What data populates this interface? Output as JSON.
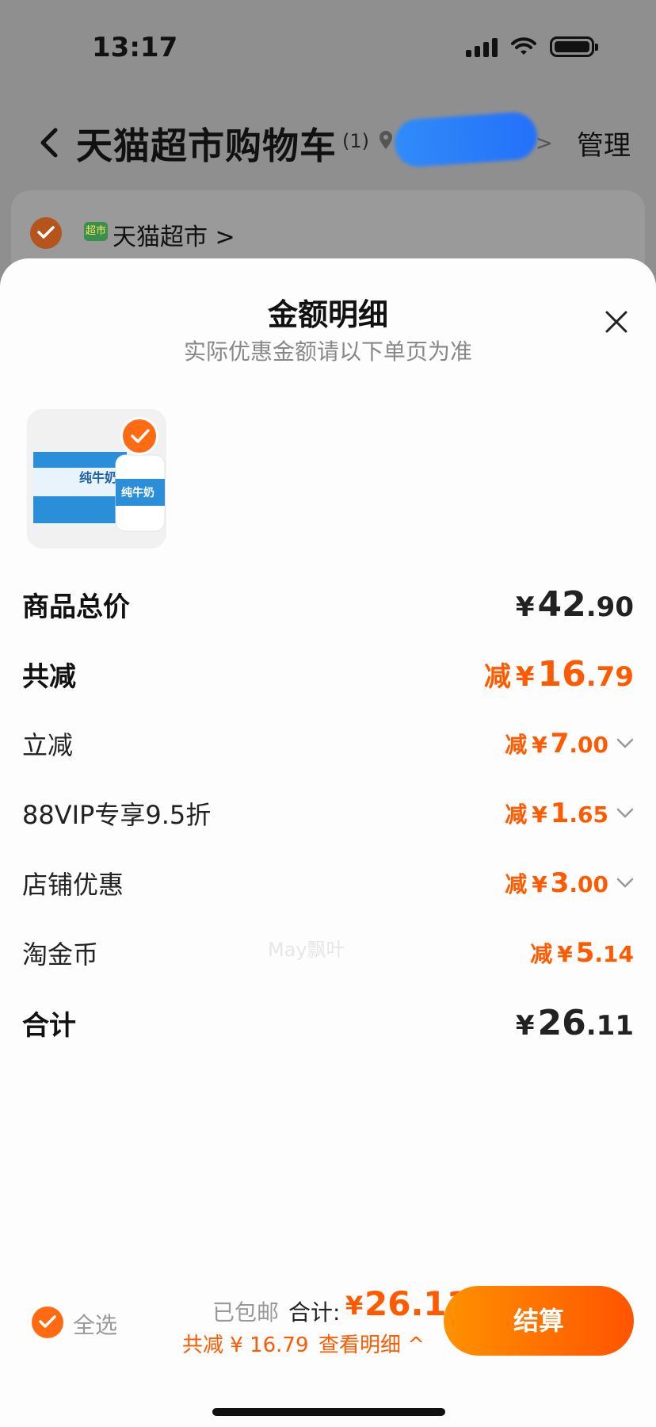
{
  "status_bar": {
    "time": "13:17"
  },
  "header": {
    "title": "天猫超市购物车",
    "count": "(1)",
    "address_chevron": ">",
    "manage_label": "管理"
  },
  "store": {
    "logo_text": "超市",
    "name": "天猫超市 >"
  },
  "sheet": {
    "title": "金额明细",
    "subtitle": "实际优惠金额请以下单页为准",
    "product": {
      "box_text": "纯牛奶",
      "bottle_text": "纯牛奶"
    },
    "rows": [
      {
        "label": "商品总价",
        "prefix": "",
        "yen": "¥",
        "int": "42",
        "dec": ".90"
      },
      {
        "label": "共减",
        "prefix": "减",
        "yen": "¥",
        "int": "16",
        "dec": ".79"
      },
      {
        "label": "立减",
        "prefix": "减",
        "yen": "¥",
        "int": "7",
        "dec": ".00"
      },
      {
        "label": "88VIP专享9.5折",
        "prefix": "减",
        "yen": "¥",
        "int": "1",
        "dec": ".65"
      },
      {
        "label": "店铺优惠",
        "prefix": "减",
        "yen": "¥",
        "int": "3",
        "dec": ".00"
      },
      {
        "label": "淘金币",
        "prefix": "减",
        "yen": "¥",
        "int": "5",
        "dec": ".14"
      },
      {
        "label": "合计",
        "prefix": "",
        "yen": "¥",
        "int": "26",
        "dec": ".11"
      }
    ],
    "watermark": "May飘叶"
  },
  "bottom_bar": {
    "select_all": "全选",
    "shipping": "已包邮",
    "total_label": "合计:",
    "total_yen": "¥",
    "total_value": "26.11",
    "saved": "共减 ¥ 16.79",
    "detail_link": "查看明细 ^",
    "checkout": "结算"
  },
  "colors": {
    "accent": "#ff5a00",
    "checkout_gradient_start": "#ff9100",
    "checkout_gradient_end": "#ff5400"
  }
}
